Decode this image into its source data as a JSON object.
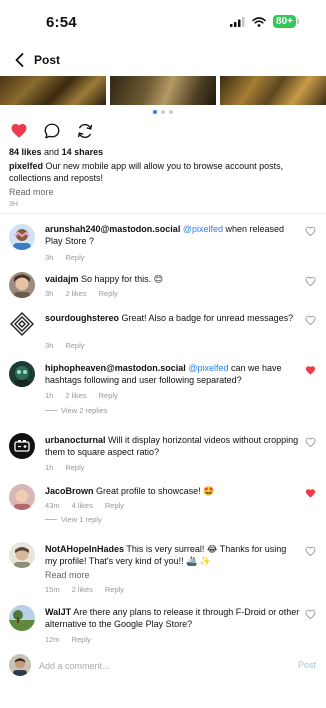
{
  "status_bar": {
    "time": "6:54",
    "battery": "80+"
  },
  "header": {
    "title": "Post"
  },
  "carousel": {
    "page_count": 3,
    "active_index": 0
  },
  "post": {
    "likes_label": "84 likes",
    "and_label": "and",
    "shares_label": "14 shares",
    "author": "pixelfed",
    "caption": "Our new mobile app will allow you to browse account posts, collections and reposts!",
    "read_more": "Read more",
    "time": "3H"
  },
  "comments": [
    {
      "user": "arunshah240@mastodon.social",
      "mention": "@pixelfed",
      "text": " when released Play Store ?",
      "time": "3h",
      "likes": "",
      "reply": "Reply",
      "liked": false
    },
    {
      "user": "vaidajm",
      "mention": "",
      "text": "So happy for this. 😊",
      "time": "3h",
      "likes": "2 likes",
      "reply": "Reply",
      "liked": false
    },
    {
      "user": "sourdoughstereo",
      "mention": "",
      "text": "Great! Also a badge for unread messages?",
      "time": "3h",
      "likes": "",
      "reply": "Reply",
      "liked": false
    },
    {
      "user": "hiphopheaven@mastodon.social",
      "mention": "@pixelfed",
      "text": " can we have hashtags following and user following separated?",
      "time": "1h",
      "likes": "2 likes",
      "reply": "Reply",
      "liked": true,
      "view_replies": "View 2 replies"
    },
    {
      "user": "urbanocturnal",
      "mention": "",
      "text": "Will it display horizontal videos without cropping them to square aspect ratio?",
      "time": "1h",
      "likes": "",
      "reply": "Reply",
      "liked": false
    },
    {
      "user": "JacoBrown",
      "mention": "",
      "text": "Great profile to showcase! 🤩",
      "time": "43m",
      "likes": "4 likes",
      "reply": "Reply",
      "liked": true,
      "view_replies": "View 1 reply"
    },
    {
      "user": "NotAHopeInHades",
      "mention": "",
      "text": "This is very surreal! 😂 Thanks for using my profile! That's very kind of you!! 🚢 ✨",
      "read_more": "Read more",
      "time": "15m",
      "likes": "2 likes",
      "reply": "Reply",
      "liked": false
    },
    {
      "user": "WalJT",
      "mention": "",
      "text": "Are there any plans to release it through F-Droid or other alternative to the Google Play Store?",
      "time": "12m",
      "likes": "",
      "reply": "Reply",
      "liked": false
    }
  ],
  "composer": {
    "placeholder": "Add a comment...",
    "post_label": "Post"
  },
  "colors": {
    "accent": "#2f80ed",
    "heart": "#ee3b4b",
    "muted": "#999999"
  }
}
